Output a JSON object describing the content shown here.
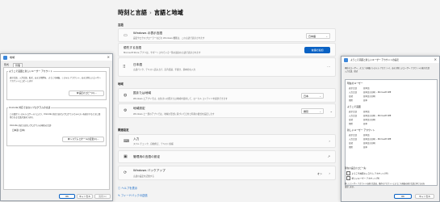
{
  "settings": {
    "breadcrumb_parent": "時刻と言語",
    "breadcrumb_sep": "›",
    "breadcrumb_current": "言語と地域",
    "section_language": "言語",
    "display_lang_title": "Windows の表示言語",
    "display_lang_sub": "設定やエクスプローラーなどの Windows 機能は、この言語で表示されます",
    "display_lang_value": "日本語",
    "preferred_title": "優先する言語",
    "preferred_sub": "Microsoft Store アプリは、サポートされている一覧の最初の言語で表示されます",
    "add_lang_button": "言語の追加",
    "japanese_title": "日本語",
    "japanese_sub": "言語パック、テキスト読み上げ、音声認識、手書き、基本的な入力",
    "section_region": "地域",
    "country_title": "国または地域",
    "country_sub": "Windows とアプリでは、お住まいの国または地域を使用して、ローカル コンテンツを提供できます",
    "country_value": "日本",
    "format_title": "地域設定",
    "format_sub": "Windows と一部のアプリでは、地域の形式に基づいて日付と時刻の書式を設定します",
    "format_value": "推奨",
    "section_related": "関連設定",
    "typing_title": "入力",
    "typing_sub": "スペル チェック、自動修正、テキスト候補",
    "admin_lang_title": "管理用の言語の設定",
    "winbackup_title": "Windows バックアップ",
    "winbackup_sub": "言語の設定を記憶する",
    "winbackup_value": "オン",
    "help_link": "ヘルプを表示",
    "feedback_link": "フィードバックの送信"
  },
  "dialog_left": {
    "title": "地域",
    "tab1": "形式",
    "tab2": "管理",
    "grp1_title": "ようこそ画面と新しいユーザー アカウント",
    "grp1_text1": "表示言語、入力言語、形式、および場所を、ようこそ画面、システム アカウント、および新しいユーザー",
    "grp1_text2": "アカウントにコピーします",
    "copy_button": "設定のコピー(C)...",
    "grp2_title": "Unicode 対応ではないプログラムの言語",
    "grp2_text1": "この設定 (システム ロケール) により、Unicode 対応ではないプログラムでテキストを表示するときに使",
    "grp2_text2": "用される言語が決まります。",
    "grp2_text3": "Unicode 対応ではないプログラムの現在の言語:",
    "grp2_value": "日本語 (日本)",
    "change_locale_button": "システム ロケールの変更(C)...",
    "ok": "OK",
    "cancel": "キャンセル",
    "apply": "適用(A)"
  },
  "dialog_right": {
    "title": "ようこそ画面と新しいユーザー アカウントの設定",
    "intro1": "現在のユーザー、ようこそ画面 (システム アカウント)、および新しいユーザー アカウントの表示言語",
    "intro2": "入力言語、形式",
    "sec_current": "現在のユーザー",
    "sec_welcome": "ようこそ画面",
    "sec_new": "新しいユーザー アカウント",
    "rows": [
      {
        "k": "表示言語",
        "v": "日本語"
      },
      {
        "k": "入力言語",
        "v": "日本語 (日本) - Microsoft IME"
      },
      {
        "k": "形式",
        "v": "日本語 (日本)"
      },
      {
        "k": "場所",
        "v": "日本"
      }
    ],
    "copy_grp": "現在の設定のコピー先:",
    "copy_chk1": "ようこそ画面とシステム アカウント(W)",
    "copy_chk2": "新しいユーザー アカウント(N)",
    "note1": "新しいユーザー アカウントの表示言語は、既存のアカウントにようこそ画面の表示言語と同じものを",
    "note2": "設定します。",
    "ok": "OK",
    "cancel": "キャンセル"
  }
}
